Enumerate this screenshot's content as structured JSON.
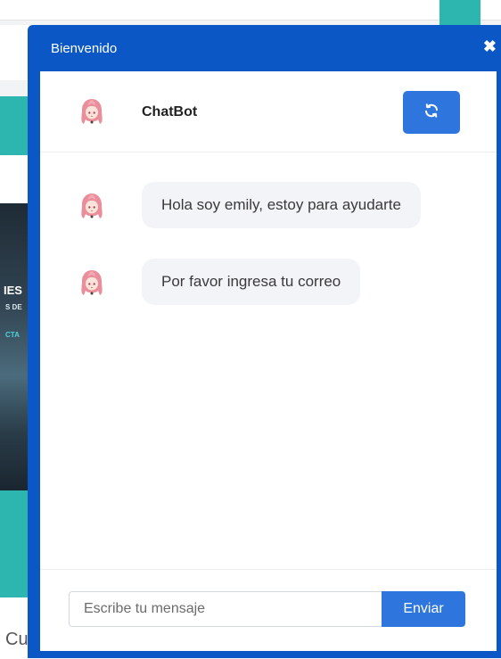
{
  "background": {
    "image_text_main": "IES",
    "image_text_sub": "S DE",
    "image_text_cta": "CTA",
    "bottom_text": "Cu"
  },
  "widget": {
    "title": "Bienvenido",
    "close_icon": "close-icon",
    "close_glyph": "✖"
  },
  "chat_header": {
    "bot_name": "ChatBot",
    "avatar_icon": "anime-girl-avatar",
    "refresh_icon": "refresh-icon"
  },
  "messages": [
    {
      "sender": "bot",
      "text": "Hola soy emily, estoy para ayudarte"
    },
    {
      "sender": "bot",
      "text": "Por favor ingresa tu correo"
    }
  ],
  "composer": {
    "placeholder": "Escribe tu mensaje",
    "value": "",
    "send_label": "Enviar"
  },
  "colors": {
    "widget_frame": "#0b57c6",
    "accent_button": "#2f75de",
    "bubble_bg": "#f3f4f8",
    "page_teal": "#2db6b0"
  }
}
